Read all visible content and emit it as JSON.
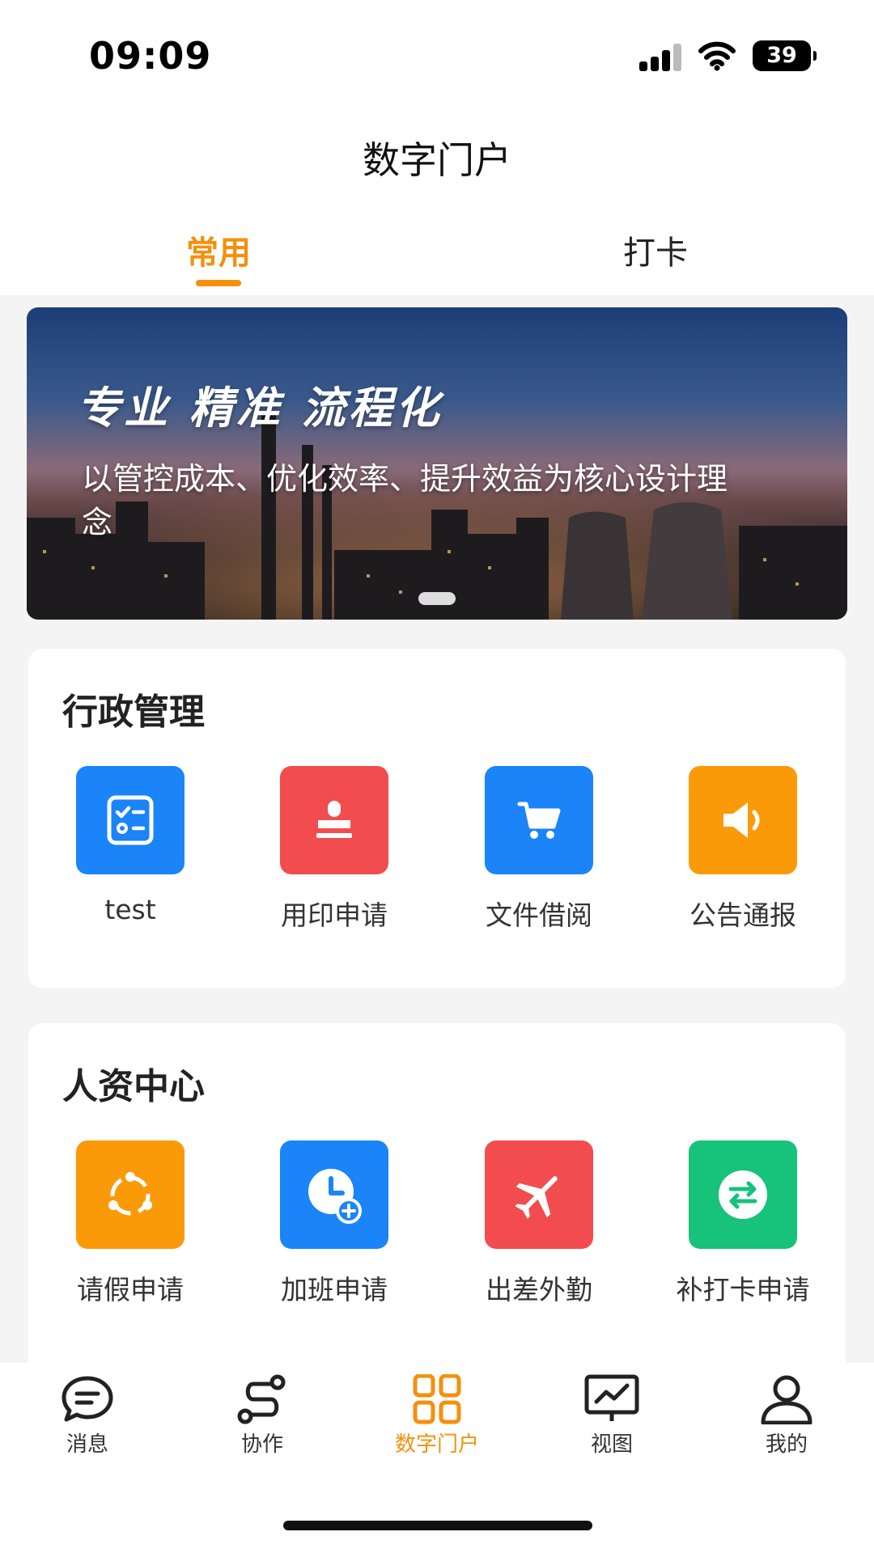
{
  "status_bar": {
    "time": "09:09",
    "battery": "39"
  },
  "header": {
    "title": "数字门户",
    "tabs": [
      {
        "label": "常用",
        "active": true
      },
      {
        "label": "打卡",
        "active": false
      }
    ]
  },
  "banner": {
    "headline": "专业 精准 流程化",
    "subtitle": "以管控成本、优化效率、提升效益为核心设计理念"
  },
  "sections": [
    {
      "title": "行政管理",
      "apps": [
        {
          "label": "test",
          "icon": "checklist-icon",
          "color": "#1a84f8"
        },
        {
          "label": "用印申请",
          "icon": "stamp-icon",
          "color": "#f24c4f"
        },
        {
          "label": "文件借阅",
          "icon": "cart-icon",
          "color": "#1a84f8"
        },
        {
          "label": "公告通报",
          "icon": "speaker-icon",
          "color": "#fb9a09"
        }
      ]
    },
    {
      "title": "人资中心",
      "apps": [
        {
          "label": "请假申请",
          "icon": "share-circle-icon",
          "color": "#fb9a09"
        },
        {
          "label": "加班申请",
          "icon": "clock-plus-icon",
          "color": "#1a84f8"
        },
        {
          "label": "出差外勤",
          "icon": "airplane-icon",
          "color": "#f24c4f"
        },
        {
          "label": "补打卡申请",
          "icon": "swap-arrows-icon",
          "color": "#17c27b"
        }
      ]
    }
  ],
  "bottom_nav": [
    {
      "label": "消息",
      "icon": "chat-icon",
      "active": false
    },
    {
      "label": "协作",
      "icon": "route-icon",
      "active": false
    },
    {
      "label": "数字门户",
      "icon": "grid-icon",
      "active": true
    },
    {
      "label": "视图",
      "icon": "chart-monitor-icon",
      "active": false
    },
    {
      "label": "我的",
      "icon": "user-icon",
      "active": false
    }
  ],
  "colors": {
    "accent": "#f5900c",
    "blue": "#1a84f8",
    "red": "#f24c4f",
    "orange": "#fb9a09",
    "green": "#17c27b"
  }
}
